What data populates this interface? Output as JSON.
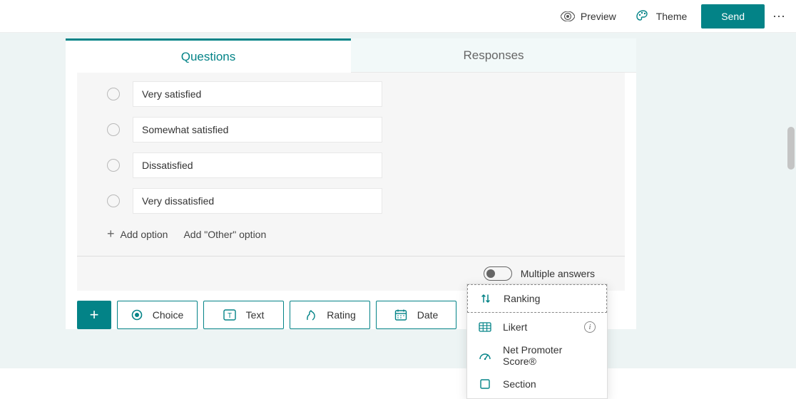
{
  "toolbar": {
    "preview_label": "Preview",
    "theme_label": "Theme",
    "send_label": "Send"
  },
  "tabs": {
    "questions": "Questions",
    "responses": "Responses"
  },
  "question": {
    "options": [
      "Very satisfied",
      "Somewhat satisfied",
      "Dissatisfied",
      "Very dissatisfied"
    ],
    "add_option_label": "Add option",
    "add_other_label": "Add \"Other\" option",
    "multiple_answers_label": "Multiple answers",
    "multiple_answers_value": false
  },
  "add_bar": {
    "choice": "Choice",
    "text": "Text",
    "rating": "Rating",
    "date": "Date"
  },
  "popup": {
    "ranking": "Ranking",
    "likert": "Likert",
    "nps": "Net Promoter Score®",
    "section": "Section"
  },
  "colors": {
    "brand": "#038387"
  }
}
